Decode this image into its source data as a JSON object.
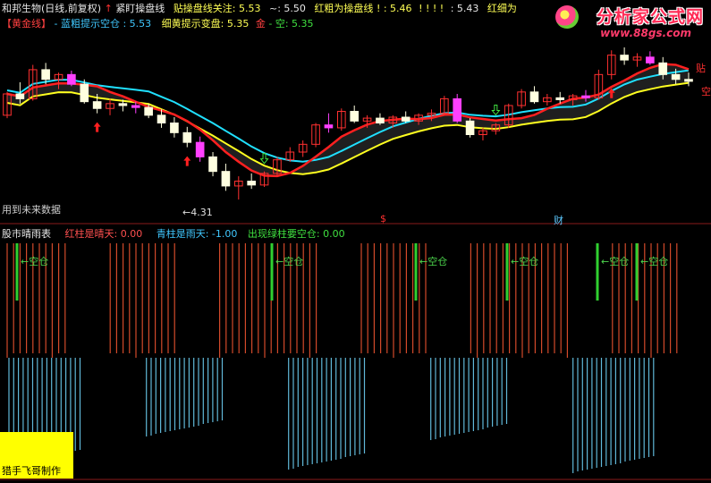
{
  "header": {
    "stock": "和邦生物(日线,前复权)",
    "line1_items": [
      {
        "text": "紧盯操盘线",
        "color": "#e8e8e8",
        "prefix_arrow": true
      },
      {
        "text": "贴操盘线关注: 5.53",
        "color": "#ffff55"
      },
      {
        "text": "~: 5.50",
        "color": "#e8e8e8"
      },
      {
        "text": "红粗为操盘线",
        "color": "#ffff55"
      },
      {
        "text": ": 5.46",
        "color": "#ffff55"
      },
      {
        "text": ": 5.43",
        "color": "#e8e8e8"
      },
      {
        "text": "红细为",
        "color": "#ffff55"
      }
    ],
    "line2_items": [
      {
        "text": "【黄金线】",
        "color": "#ff4040"
      },
      {
        "text": "- 蓝粗提示空仓",
        "color": "#40c8ff"
      },
      {
        "text": ": 5.53",
        "color": "#40c8ff"
      },
      {
        "text": "细黄提示变盘: 5.35",
        "color": "#ffff55"
      },
      {
        "text": "金",
        "color": "#ff4040"
      },
      {
        "text": "- 空: 5.35",
        "color": "#40e040"
      }
    ]
  },
  "annotations": {
    "future_data": "用到未来数据",
    "low_price": "←4.31",
    "marker_dollar": "$",
    "marker_cai": "财",
    "right_label_1": "贴",
    "right_label_2": "空"
  },
  "sub_header": {
    "title": "股市晴雨表",
    "red_label": "红柱是晴天: 0.00",
    "blue_label": "青柱是雨天: -1.00",
    "green_label": "出现绿柱要空仓: 0.00"
  },
  "signals": {
    "label": "←空仓",
    "positions": [
      19,
      304,
      465,
      567,
      668,
      712
    ]
  },
  "footer": {
    "credit": "猎手飞哥制作"
  },
  "watermark": {
    "name": "分析家公式网",
    "url": "www.88gs.com"
  },
  "colors": {
    "up": "#ff3030",
    "down": "#30c8c8",
    "neutral": "#ffffe0",
    "pink": "#ff40ff",
    "green": "#30d030",
    "ma_red": "#ff2020",
    "ma_yellow": "#ffff20",
    "ma_cyan": "#20e0ff",
    "red_bar": "#d24a2a",
    "cyan_bar": "#60b8d8"
  },
  "chart_data": {
    "type": "candlestick",
    "title": "",
    "xlabel": "",
    "ylabel": "",
    "ylim": [
      4.2,
      6.0
    ],
    "candles": [
      [
        5.18,
        5.42,
        5.15,
        5.4
      ],
      [
        5.4,
        5.52,
        5.3,
        5.35
      ],
      [
        5.35,
        5.7,
        5.33,
        5.65
      ],
      [
        5.65,
        5.72,
        5.5,
        5.55
      ],
      [
        5.55,
        5.62,
        5.45,
        5.6
      ],
      [
        5.6,
        5.64,
        5.48,
        5.5
      ],
      [
        5.5,
        5.55,
        5.3,
        5.32
      ],
      [
        5.32,
        5.4,
        5.2,
        5.25
      ],
      [
        5.25,
        5.35,
        5.18,
        5.3
      ],
      [
        5.3,
        5.34,
        5.22,
        5.28
      ],
      [
        5.28,
        5.32,
        5.2,
        5.26
      ],
      [
        5.26,
        5.3,
        5.15,
        5.18
      ],
      [
        5.18,
        5.24,
        5.05,
        5.1
      ],
      [
        5.1,
        5.16,
        4.95,
        5.0
      ],
      [
        5.0,
        5.06,
        4.85,
        4.9
      ],
      [
        4.9,
        4.96,
        4.7,
        4.75
      ],
      [
        4.75,
        4.8,
        4.55,
        4.6
      ],
      [
        4.6,
        4.68,
        4.4,
        4.45
      ],
      [
        4.45,
        4.55,
        4.31,
        4.5
      ],
      [
        4.5,
        4.58,
        4.42,
        4.46
      ],
      [
        4.46,
        4.6,
        4.44,
        4.58
      ],
      [
        4.58,
        4.75,
        4.55,
        4.72
      ],
      [
        4.72,
        4.85,
        4.7,
        4.8
      ],
      [
        4.8,
        4.92,
        4.75,
        4.88
      ],
      [
        4.88,
        5.1,
        4.85,
        5.08
      ],
      [
        5.08,
        5.2,
        5.0,
        5.05
      ],
      [
        5.05,
        5.25,
        5.02,
        5.22
      ],
      [
        5.22,
        5.28,
        5.1,
        5.12
      ],
      [
        5.12,
        5.18,
        5.05,
        5.15
      ],
      [
        5.15,
        5.2,
        5.08,
        5.1
      ],
      [
        5.1,
        5.18,
        5.05,
        5.16
      ],
      [
        5.16,
        5.22,
        5.1,
        5.12
      ],
      [
        5.12,
        5.2,
        5.08,
        5.18
      ],
      [
        5.18,
        5.24,
        5.12,
        5.2
      ],
      [
        5.2,
        5.38,
        5.18,
        5.35
      ],
      [
        5.35,
        5.4,
        5.1,
        5.12
      ],
      [
        5.12,
        5.15,
        4.95,
        4.98
      ],
      [
        4.98,
        5.05,
        4.92,
        5.02
      ],
      [
        5.02,
        5.1,
        4.98,
        5.08
      ],
      [
        5.08,
        5.3,
        5.05,
        5.28
      ],
      [
        5.28,
        5.45,
        5.25,
        5.42
      ],
      [
        5.42,
        5.48,
        5.3,
        5.32
      ],
      [
        5.32,
        5.4,
        5.28,
        5.36
      ],
      [
        5.36,
        5.42,
        5.3,
        5.34
      ],
      [
        5.34,
        5.4,
        5.28,
        5.38
      ],
      [
        5.38,
        5.44,
        5.32,
        5.36
      ],
      [
        5.36,
        5.65,
        5.34,
        5.6
      ],
      [
        5.6,
        5.85,
        5.55,
        5.8
      ],
      [
        5.8,
        5.88,
        5.7,
        5.75
      ],
      [
        5.75,
        5.82,
        5.68,
        5.78
      ],
      [
        5.78,
        5.84,
        5.7,
        5.72
      ],
      [
        5.72,
        5.78,
        5.55,
        5.6
      ],
      [
        5.6,
        5.66,
        5.5,
        5.55
      ],
      [
        5.55,
        5.62,
        5.48,
        5.53
      ]
    ],
    "x_markers": [
      "$",
      "财"
    ]
  }
}
